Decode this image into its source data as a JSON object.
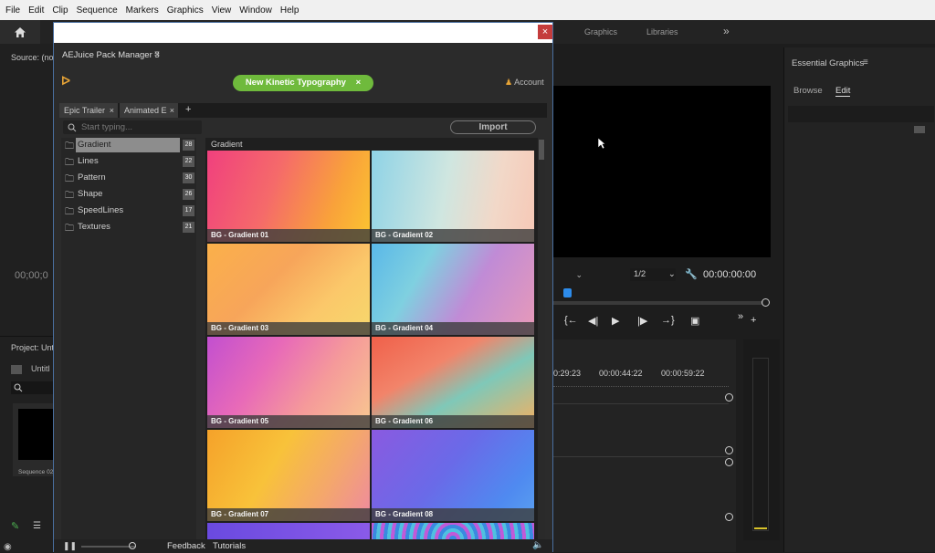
{
  "menu": [
    "File",
    "Edit",
    "Clip",
    "Sequence",
    "Markers",
    "Graphics",
    "View",
    "Window",
    "Help"
  ],
  "app": {
    "tabs_right": [
      "Graphics",
      "Libraries"
    ],
    "source_label": "Source: (no",
    "source_timecode": "00;00;0",
    "project_label": "Project: Unt",
    "project_item": "Untitl",
    "sequence_thumb_label": "Sequence 02",
    "essential_title": "Essential Graphics",
    "essential_tabs": [
      "Browse",
      "Edit"
    ],
    "program": {
      "zoom": "1/2",
      "timecode": "00:00:00:00"
    },
    "timeline_times": [
      "0:29:23",
      "00:00:44:22",
      "00:00:59:22"
    ]
  },
  "dialog": {
    "title": "AEJuice Pack Manager 3",
    "pill": "New Kinetic Typography",
    "pill_close": "×",
    "account": "Account",
    "tabs": [
      "Epic Trailer",
      "Animated E"
    ],
    "search_placeholder": "Start typing...",
    "import_label": "Import",
    "grid_label": "Gradient",
    "categories": [
      {
        "name": "Gradient",
        "count": "28"
      },
      {
        "name": "Lines",
        "count": "22"
      },
      {
        "name": "Pattern",
        "count": "30"
      },
      {
        "name": "Shape",
        "count": "26"
      },
      {
        "name": "SpeedLines",
        "count": "17"
      },
      {
        "name": "Textures",
        "count": "21"
      }
    ],
    "thumbs": [
      "BG - Gradient 01",
      "BG - Gradient 02",
      "BG - Gradient 03",
      "BG - Gradient 04",
      "BG - Gradient 05",
      "BG - Gradient 06",
      "BG - Gradient 07",
      "BG - Gradient 08"
    ],
    "footer": {
      "feedback": "Feedback",
      "tutorials": "Tutorials"
    }
  },
  "colors": {
    "accent_green": "#6fba3c",
    "logo_orange": "#e6a336",
    "close_red": "#c43c3c",
    "playhead_blue": "#2d8ceb"
  }
}
